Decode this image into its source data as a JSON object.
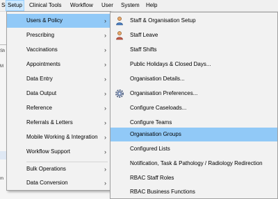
{
  "menubar": {
    "items": [
      "Setup",
      "Clinical Tools",
      "Workflow",
      "User",
      "System",
      "Help"
    ]
  },
  "background": {
    "fragments": [
      "Sh",
      "M",
      "m"
    ]
  },
  "setup_menu": {
    "items": [
      {
        "label": "Users & Policy",
        "has_submenu": true,
        "highlighted": true
      },
      {
        "label": "Prescribing",
        "has_submenu": true
      },
      {
        "label": "Vaccinations",
        "has_submenu": true
      },
      {
        "label": "Appointments",
        "has_submenu": true
      },
      {
        "label": "Data Entry",
        "has_submenu": true
      },
      {
        "label": "Data Output",
        "has_submenu": true
      },
      {
        "label": "Reference",
        "has_submenu": true
      },
      {
        "label": "Referrals & Letters",
        "has_submenu": true
      },
      {
        "label": "Mobile Working & Integration",
        "has_submenu": true
      },
      {
        "label": "Workflow Support",
        "has_submenu": true
      },
      {
        "label": "Bulk Operations",
        "has_submenu": true
      },
      {
        "label": "Data Conversion",
        "has_submenu": true
      }
    ],
    "arrow": "›"
  },
  "users_policy_submenu": {
    "items": [
      {
        "label": "Staff & Organisation Setup",
        "icon": "users-icon"
      },
      {
        "label": "Staff Leave",
        "icon": "user-leave-icon"
      },
      {
        "label": "Staff Shifts"
      },
      {
        "label": "Public Holidays & Closed Days..."
      },
      {
        "label": "Organisation Details..."
      },
      {
        "label": "Organisation Preferences...",
        "icon": "gear-icon"
      },
      {
        "label": "Configure Caseloads..."
      },
      {
        "label": "Configure Teams"
      },
      {
        "label": "Organisation Groups",
        "highlighted": true
      },
      {
        "label": "Configured Lists"
      },
      {
        "label": "Notification, Task & Pathology / Radiology Redirection"
      },
      {
        "label": "RBAC Staff Roles"
      },
      {
        "label": "RBAC Business Functions"
      }
    ]
  },
  "colors": {
    "highlight": "#91c9f7",
    "menubar_active": "#cce8ff",
    "menu_bg": "#f2f2f2"
  }
}
